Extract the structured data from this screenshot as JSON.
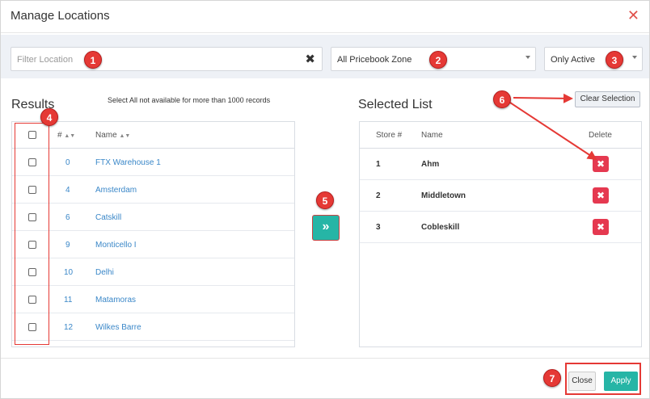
{
  "dialog": {
    "title": "Manage Locations",
    "close_icon": "close-icon"
  },
  "filters": {
    "filter_placeholder": "Filter Location",
    "clear_glyph": "✖",
    "zone_value": "All Pricebook Zone",
    "status_value": "Only Active"
  },
  "results": {
    "title": "Results",
    "note": "Select All not available for more than 1000 records",
    "col_num": "#",
    "col_name": "Name",
    "rows": [
      {
        "num": "0",
        "name": "FTX Warehouse 1"
      },
      {
        "num": "4",
        "name": "Amsterdam"
      },
      {
        "num": "6",
        "name": "Catskill"
      },
      {
        "num": "9",
        "name": "Monticello I"
      },
      {
        "num": "10",
        "name": "Delhi"
      },
      {
        "num": "11",
        "name": "Matamoras"
      },
      {
        "num": "12",
        "name": "Wilkes Barre"
      }
    ]
  },
  "move_button": {
    "glyph": "»"
  },
  "selected": {
    "title": "Selected List",
    "clear_label": "Clear Selection",
    "col_store": "Store #",
    "col_name": "Name",
    "col_delete": "Delete",
    "rows": [
      {
        "num": "1",
        "name": "Ahm"
      },
      {
        "num": "2",
        "name": "Middletown"
      },
      {
        "num": "3",
        "name": "Cobleskill"
      }
    ]
  },
  "footer": {
    "close_label": "Close",
    "apply_label": "Apply"
  },
  "badges": [
    "1",
    "2",
    "3",
    "4",
    "5",
    "6",
    "7"
  ],
  "colors": {
    "accent": "#26b5a6",
    "danger": "#e53950",
    "link": "#3a87c8",
    "annotation": "#e53935"
  }
}
